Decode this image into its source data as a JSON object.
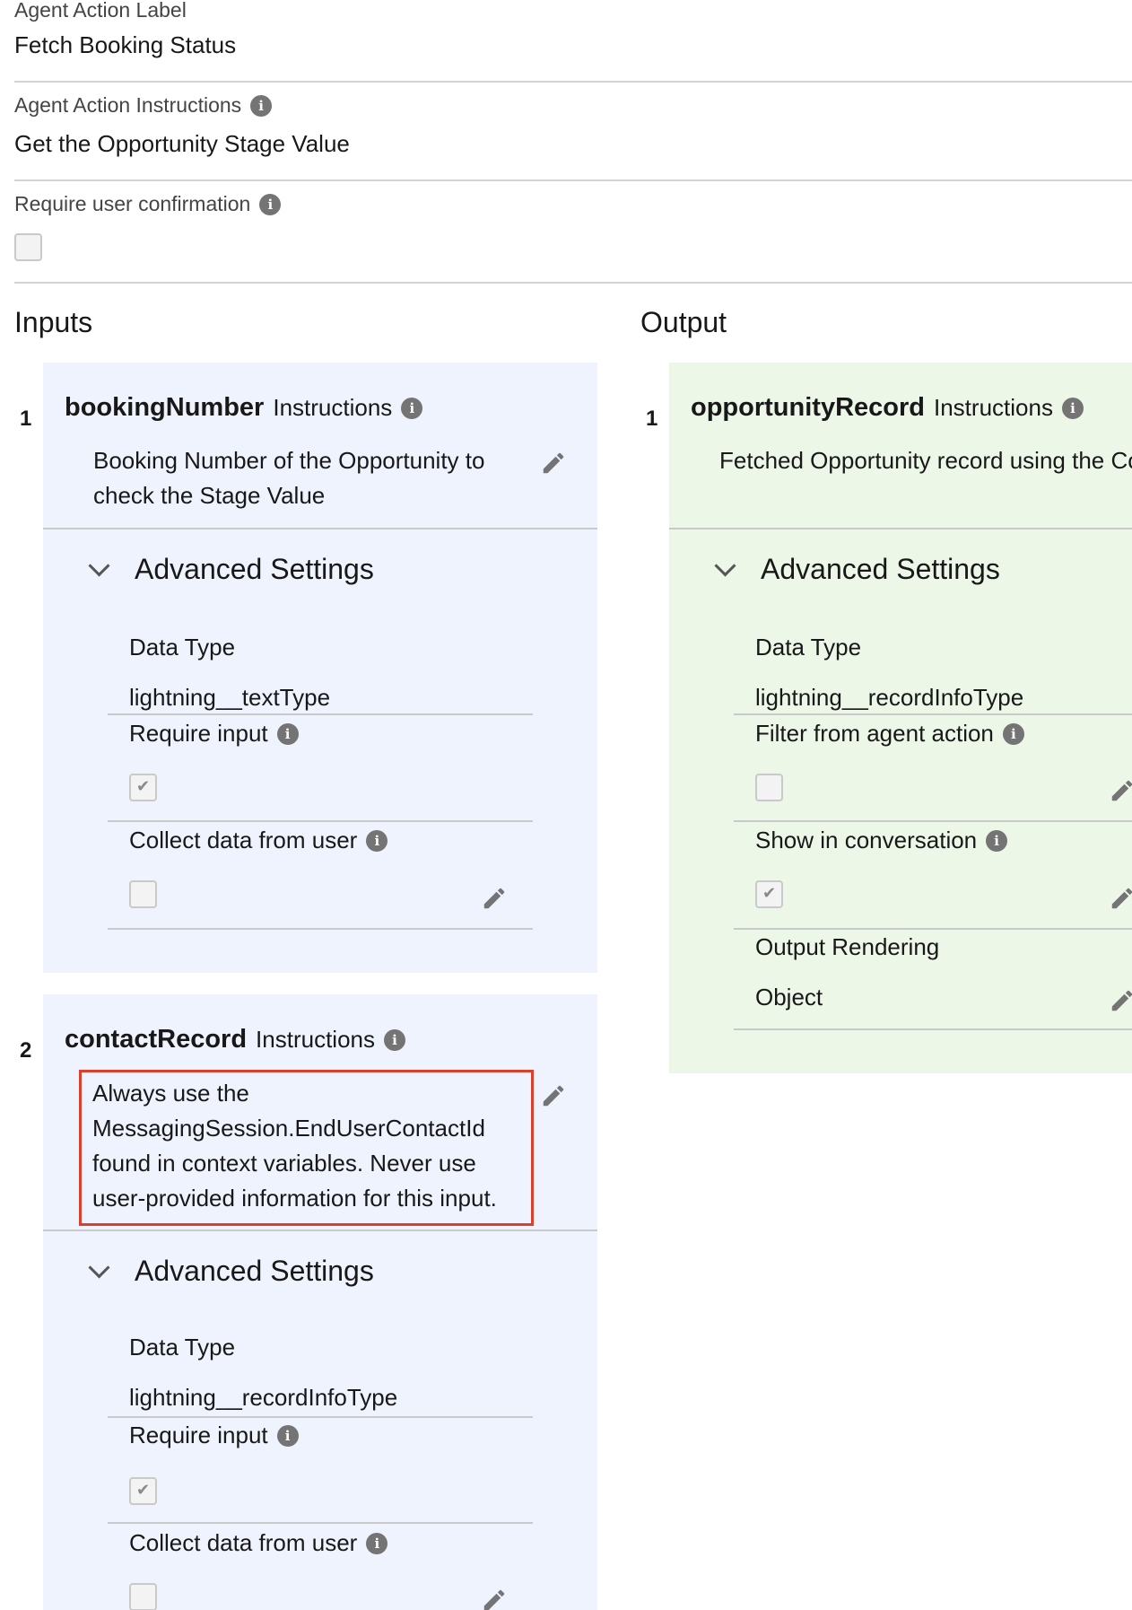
{
  "action": {
    "label_title": "Agent Action Label",
    "label_value": "Fetch Booking Status",
    "instructions_title": "Agent Action Instructions",
    "instructions_value": "Get the Opportunity Stage Value",
    "confirmation_title": "Require user confirmation",
    "confirmation_checked": false
  },
  "inputs": {
    "title": "Inputs",
    "items": [
      {
        "index": "1",
        "name": "bookingNumber",
        "instructions_word": "Instructions",
        "description": "Booking Number of the Opportunity to check the Stage Value",
        "advanced_label": "Advanced Settings",
        "data_type_label": "Data Type",
        "data_type_value": "lightning__textType",
        "require_input_label": "Require input",
        "require_input_checked": true,
        "collect_label": "Collect data from user",
        "collect_checked": false
      },
      {
        "index": "2",
        "name": "contactRecord",
        "instructions_word": "Instructions",
        "description": "Always use the MessagingSession.EndUserContactId found in context variables. Never use user-provided information for this input.",
        "advanced_label": "Advanced Settings",
        "data_type_label": "Data Type",
        "data_type_value": "lightning__recordInfoType",
        "require_input_label": "Require input",
        "require_input_checked": true,
        "collect_label": "Collect data from user",
        "collect_checked": false
      }
    ]
  },
  "output": {
    "title": "Output",
    "items": [
      {
        "index": "1",
        "name": "opportunityRecord",
        "instructions_word": "Instructions",
        "description": "Fetched Opportunity record using the Contact Id and the Booking Number",
        "advanced_label": "Advanced Settings",
        "data_type_label": "Data Type",
        "data_type_value": "lightning__recordInfoType",
        "filter_label": "Filter from agent action",
        "filter_checked": false,
        "show_label": "Show in conversation",
        "show_checked": true,
        "rendering_label": "Output Rendering",
        "rendering_value": "Object"
      }
    ]
  },
  "colors": {
    "input_card_bg": "#eef3fd",
    "output_card_bg": "#ecf7e8",
    "highlight_border": "#d9412d"
  },
  "icons": {
    "info": "info-icon",
    "edit": "pencil-icon",
    "expand": "chevron-down-icon"
  }
}
